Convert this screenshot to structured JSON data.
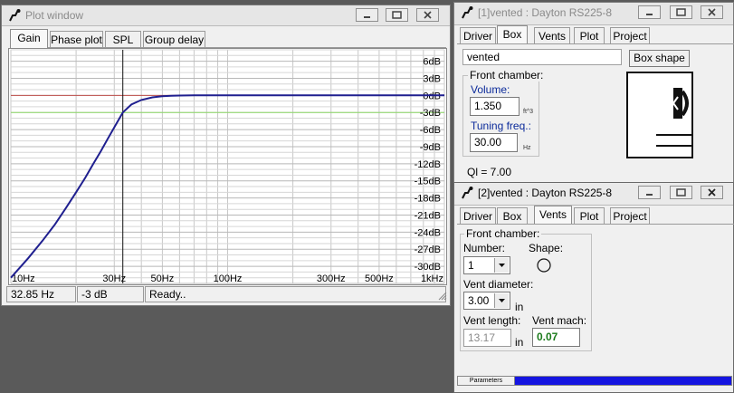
{
  "plot_window": {
    "title": "Plot window",
    "tabs": [
      "Gain",
      "Phase plot",
      "SPL",
      "Group delay"
    ],
    "selected_tab": "Gain",
    "status": {
      "frequency": "32.85 Hz",
      "level": "-3 dB",
      "message": "Ready.."
    }
  },
  "chart_data": {
    "type": "line",
    "x_scale": "log",
    "xlim": [
      10,
      1000
    ],
    "ylim": [
      -33,
      8
    ],
    "x_tick_labels": [
      "10Hz",
      "30Hz",
      "50Hz",
      "100Hz",
      "300Hz",
      "500Hz",
      "1kHz"
    ],
    "x_ticks": [
      10,
      30,
      50,
      100,
      300,
      500,
      1000
    ],
    "y_tick_labels": [
      "6dB",
      "3dB",
      "0dB",
      "-3dB",
      "-6dB",
      "-9dB",
      "-12dB",
      "-15dB",
      "-18dB",
      "-21dB",
      "-24dB",
      "-27dB",
      "-30dB"
    ],
    "y_ticks": [
      6,
      3,
      0,
      -3,
      -6,
      -9,
      -12,
      -15,
      -18,
      -21,
      -24,
      -27,
      -30
    ],
    "grid": true,
    "cursor_x": 32.85,
    "reference_lines": [
      {
        "y": 0,
        "color": "#c0504d"
      },
      {
        "y": -3,
        "color": "#8fdc6a"
      }
    ],
    "series": [
      {
        "color": "#1f1f8f",
        "x": [
          10,
          12,
          14,
          16,
          18,
          20,
          22,
          24,
          26,
          28,
          30,
          32.85,
          36,
          40,
          45,
          50,
          55,
          60,
          70,
          80,
          100,
          150,
          200,
          300,
          500,
          1000
        ],
        "y": [
          -32.0,
          -28.6,
          -25.5,
          -22.6,
          -19.7,
          -17.0,
          -14.5,
          -12.0,
          -9.8,
          -7.6,
          -5.6,
          -3.0,
          -1.6,
          -0.8,
          -0.35,
          -0.15,
          -0.06,
          -0.02,
          0,
          0,
          0,
          0,
          0,
          0,
          0,
          0
        ]
      }
    ]
  },
  "vented1": {
    "title": "[1]vented : Dayton RS225-8",
    "tabs": [
      "Driver",
      "Box",
      "Vents",
      "Plot",
      "Project"
    ],
    "selected_tab": "Box",
    "box_name": "vented",
    "box_shape_label": "Box shape",
    "front_chamber_label": "Front chamber:",
    "volume_label": "Volume:",
    "volume_value": "1.350",
    "volume_unit": "ft^3",
    "tuning_label": "Tuning freq.:",
    "tuning_value": "30.00",
    "tuning_unit": "Hz",
    "ql_text": "Ql = 7.00"
  },
  "vented2": {
    "title": "[2]vented : Dayton RS225-8",
    "tabs": [
      "Driver",
      "Box",
      "Vents",
      "Plot",
      "Project"
    ],
    "selected_tab": "Vents",
    "front_chamber_label": "Front chamber:",
    "number_label": "Number:",
    "number_value": "1",
    "shape_label": "Shape:",
    "diameter_label": "Vent diameter:",
    "diameter_value": "3.00",
    "diameter_unit": "in",
    "length_label": "Vent length:",
    "length_value": "13.17",
    "length_unit": "in",
    "mach_label": "Vent mach:",
    "mach_value": "0.07",
    "parameters_label": "Parameters"
  }
}
